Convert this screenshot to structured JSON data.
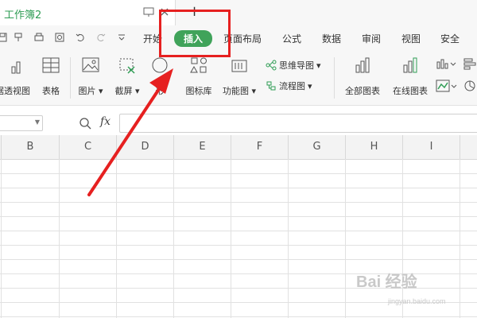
{
  "titlebar": {
    "doc_title": "工作簿2",
    "new_tab": "+"
  },
  "menu": {
    "tabs": [
      {
        "label": "开始"
      },
      {
        "label": "插入"
      },
      {
        "label": "页面布局"
      },
      {
        "label": "公式"
      },
      {
        "label": "数据"
      },
      {
        "label": "审阅"
      },
      {
        "label": "视图"
      },
      {
        "label": "安全"
      }
    ],
    "active_tab": "插入"
  },
  "ribbon": {
    "pivot_view": "据透视图",
    "table": "表格",
    "picture": "图片",
    "screenshot": "截屏",
    "shape": "形",
    "icon_library": "图标库",
    "function_chart": "功能图",
    "mind_map": "思维导图",
    "flowchart": "流程图",
    "all_charts": "全部图表",
    "online_chart": "在线图表"
  },
  "formula_bar": {
    "fx_label": "fx",
    "value": ""
  },
  "grid": {
    "columns": [
      "B",
      "C",
      "D",
      "E",
      "F",
      "G",
      "H",
      "I"
    ]
  },
  "watermark": {
    "text": "Bai 经验",
    "sub": "jingyan.baidu.com"
  },
  "colors": {
    "accent": "#40a35a",
    "title_green": "#2f9d55",
    "annotation_red": "#e62020"
  }
}
